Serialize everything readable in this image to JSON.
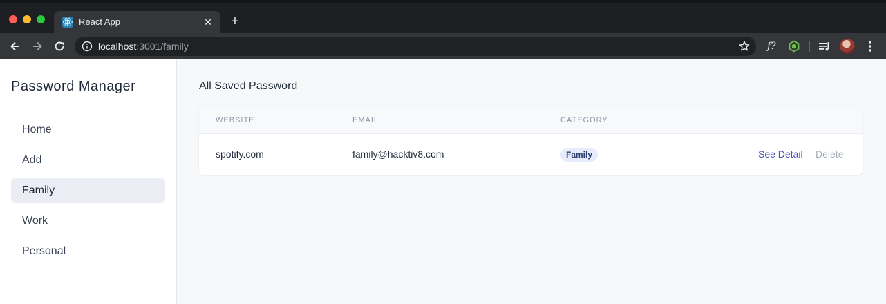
{
  "browser": {
    "tab_title": "React App",
    "url_host": "localhost",
    "url_path": ":3001/family",
    "extension_label": "f?",
    "icons": {
      "favicon": "react-icon",
      "back": "back-arrow-icon",
      "forward": "forward-arrow-icon",
      "reload": "reload-icon",
      "info": "info-icon",
      "bookmark": "star-icon",
      "extension_node": "nodejs-icon",
      "media": "media-queue-icon",
      "menu": "kebab-icon"
    }
  },
  "sidebar": {
    "title": "Password Manager",
    "items": [
      {
        "label": "Home",
        "active": false
      },
      {
        "label": "Add",
        "active": false
      },
      {
        "label": "Family",
        "active": true
      },
      {
        "label": "Work",
        "active": false
      },
      {
        "label": "Personal",
        "active": false
      }
    ]
  },
  "main": {
    "title": "All Saved Password",
    "table": {
      "headers": [
        "WEBSITE",
        "EMAIL",
        "CATEGORY"
      ],
      "rows": [
        {
          "website": "spotify.com",
          "email": "family@hacktiv8.com",
          "category": "Family",
          "detail_label": "See Detail",
          "delete_label": "Delete"
        }
      ]
    }
  },
  "colors": {
    "active_nav_bg": "#eaedf3",
    "badge_bg": "#e6ecfb",
    "link": "#4650b5",
    "muted_link": "#a7adb9"
  }
}
